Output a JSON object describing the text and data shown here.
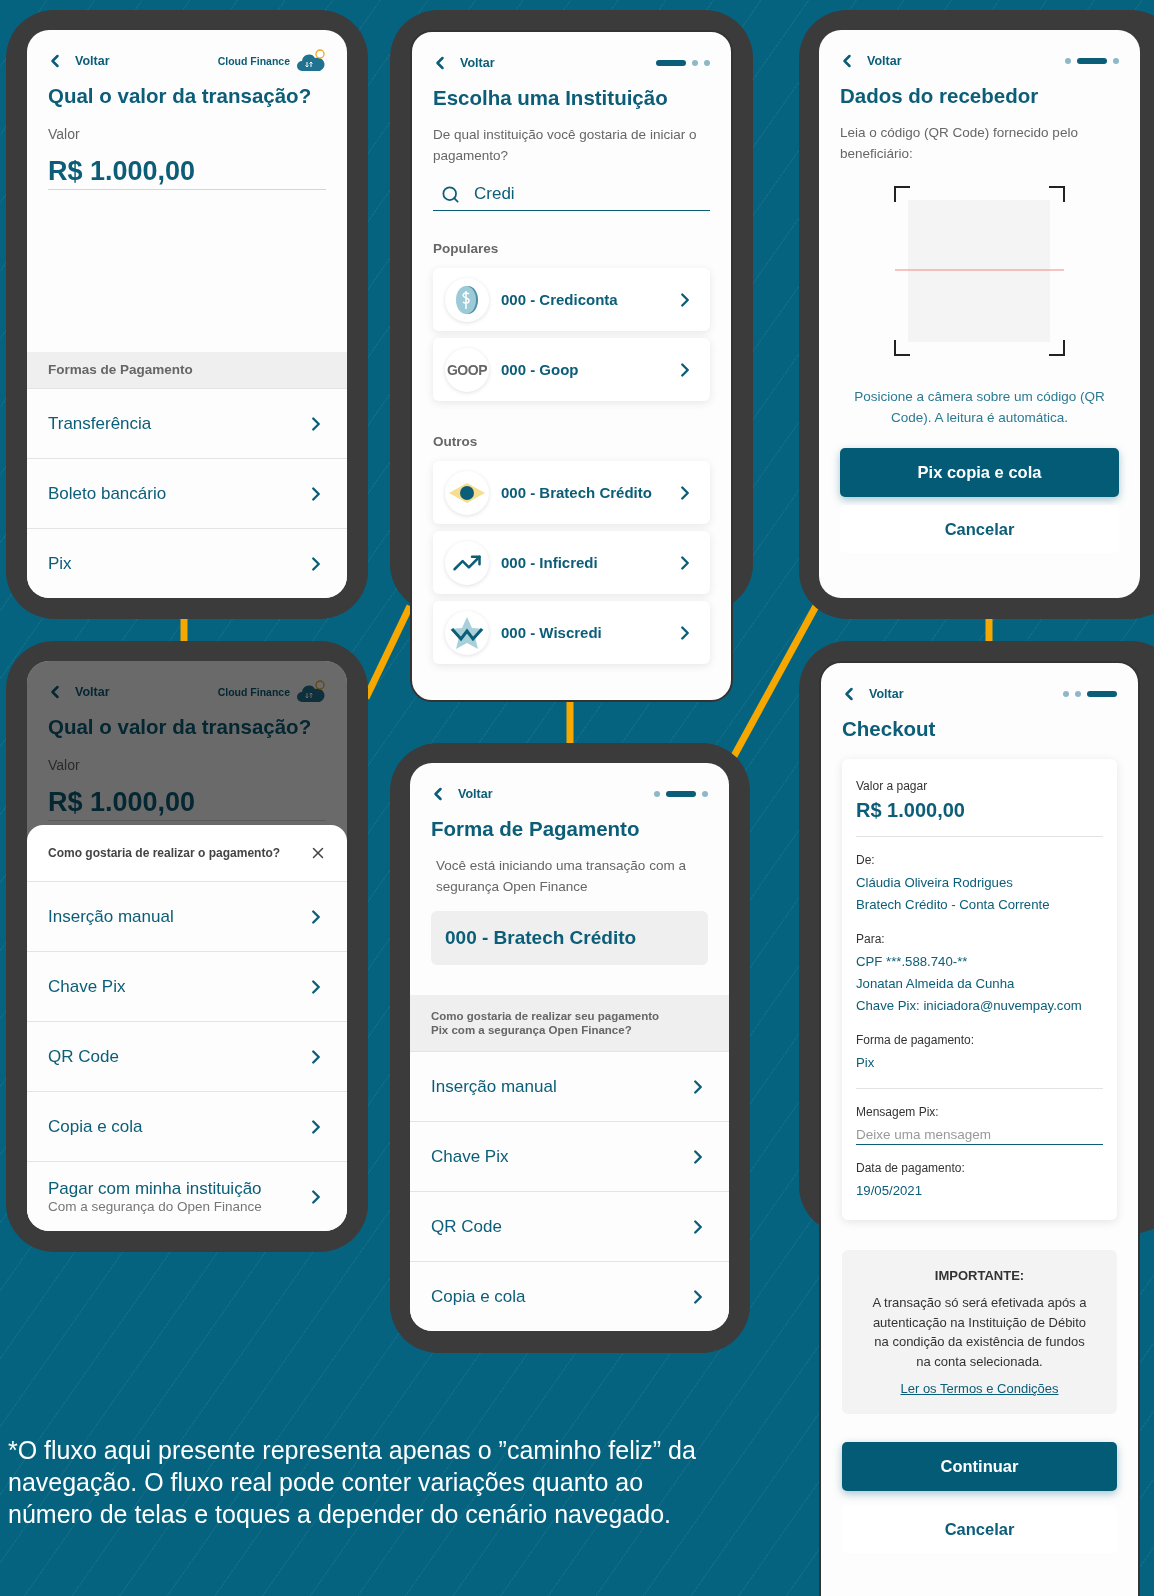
{
  "screens": [
    {
      "kind": "amount",
      "back": "Voltar",
      "brand": "Cloud Finance",
      "title": "Qual o valor da transação?",
      "field_label": "Valor",
      "amount": "R$ 1.000,00",
      "section": "Formas de Pagamento",
      "options": [
        {
          "label": "Transferência"
        },
        {
          "label": "Boleto bancário"
        },
        {
          "label": "Pix"
        }
      ]
    },
    {
      "kind": "institutions",
      "back": "Voltar",
      "steps": [
        {
          "selected": true
        },
        {
          "selected": false
        },
        {
          "selected": false
        }
      ],
      "title": "Escolha uma Instituição",
      "subtitle": "De qual instituição você gostaria de iniciar o pagamento?",
      "search": {
        "value": "Credi"
      },
      "groups": [
        {
          "label": "Populares",
          "items": [
            {
              "name": "000 - Crediconta",
              "kind": "coin"
            },
            {
              "name": "000 - Goop",
              "kind": "wordmark",
              "logo_text": "GOOP"
            }
          ]
        },
        {
          "label": "Outros",
          "items": [
            {
              "name": "000 - Bratech Crédito",
              "kind": "diamond"
            },
            {
              "name": "000 - Inficredi",
              "kind": "trend"
            },
            {
              "name": "000 - Wiscredi",
              "kind": "star"
            }
          ]
        }
      ]
    },
    {
      "kind": "scanner",
      "back": "Voltar",
      "steps": [
        {
          "selected": false
        },
        {
          "selected": true
        },
        {
          "selected": false
        }
      ],
      "title": "Dados do recebedor",
      "subtitle": "Leia o código (QR Code) fornecido pelo beneficiário:",
      "hint": "Posicione a câmera sobre um código (QR Code). A leitura é automática.",
      "primary": "Pix copia e cola",
      "secondary": "Cancelar"
    },
    {
      "kind": "amount_sheet",
      "back": "Voltar",
      "brand": "Cloud Finance",
      "title": "Qual o valor da transação?",
      "field_label": "Valor",
      "amount": "R$ 1.000,00",
      "sheet": {
        "title": "Como gostaria de realizar o pagamento?",
        "options": [
          {
            "label": "Inserção manual"
          },
          {
            "label": "Chave Pix"
          },
          {
            "label": "QR Code"
          },
          {
            "label": "Copia e cola"
          },
          {
            "label": "Pagar com minha instituição",
            "caption": "Com a segurança do Open Finance"
          }
        ]
      }
    },
    {
      "kind": "payment_method",
      "back": "Voltar",
      "steps": [
        {
          "selected": false
        },
        {
          "selected": true
        },
        {
          "selected": false
        }
      ],
      "title": "Forma de Pagamento",
      "subtitle": "Você está iniciando uma transação com a segurança Open Finance",
      "institution": "000 - Bratech Crédito",
      "section": "Como gostaria de realizar seu pagamento Pix com a segurança Open Finance?",
      "options": [
        {
          "label": "Inserção manual"
        },
        {
          "label": "Chave Pix"
        },
        {
          "label": "QR Code"
        },
        {
          "label": "Copia e cola"
        }
      ]
    },
    {
      "kind": "checkout",
      "back": "Voltar",
      "steps": [
        {
          "selected": false
        },
        {
          "selected": false
        },
        {
          "selected": true
        }
      ],
      "title": "Checkout",
      "card": {
        "label": "Valor a pagar",
        "amount": "R$ 1.000,00",
        "sections": [
          {
            "label": "De:",
            "lines": [
              "Cláudia Oliveira Rodrigues",
              "Bratech Crédito - Conta Corrente"
            ]
          },
          {
            "label": "Para:",
            "lines": [
              "CPF ***.588.740-**",
              "Jonatan Almeida da Cunha",
              "Chave Pix: iniciadora@nuvempay.com"
            ]
          },
          {
            "label": "Forma de pagamento:",
            "lines": [
              "Pix"
            ]
          }
        ],
        "message": {
          "label": "Mensagem Pix:",
          "placeholder": "Deixe uma mensagem"
        },
        "date": {
          "label": "Data de pagamento:",
          "value": "19/05/2021"
        }
      },
      "notice": {
        "title": "IMPORTANTE:",
        "text": "A transação só será efetivada após a autenticação na Instituição de Débito na condição da existência de fundos na conta selecionada.",
        "link": "Ler os Termos e Condições"
      },
      "primary": "Continuar",
      "secondary": "Cancelar"
    }
  ],
  "footnote": "*O fluxo aqui presente representa apenas o ”caminho feliz” da navegação. O fluxo real pode conter variações quanto ao número de telas e toques a depender do cenário navegado."
}
